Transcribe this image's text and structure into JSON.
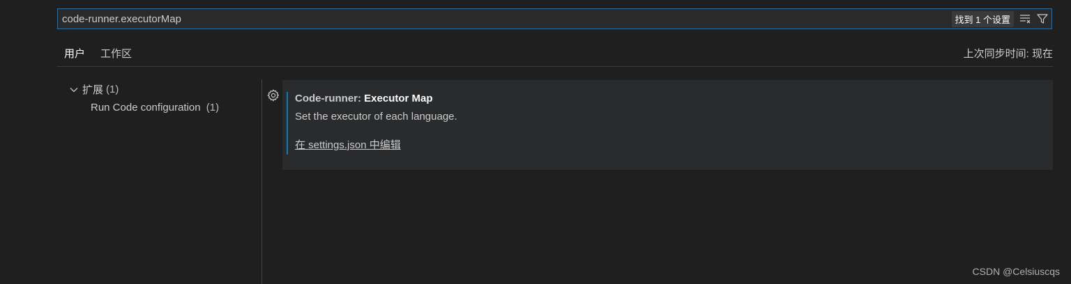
{
  "search": {
    "value": "code-runner.executorMap",
    "result_badge": "找到 1 个设置",
    "clear_filter_icon": "clear-filter-icon",
    "filter_icon": "filter-icon"
  },
  "tabs": {
    "user": "用户",
    "workspace": "工作区"
  },
  "sync_status": "上次同步时间: 现在",
  "toc": {
    "group_label": "扩展",
    "group_count": "(1)",
    "item_label": "Run Code configuration",
    "item_count": "(1)"
  },
  "setting": {
    "category": "Code-runner: ",
    "name": "Executor Map",
    "description": "Set the executor of each language.",
    "edit_link": "在 settings.json 中编辑",
    "gear_icon": "gear-icon"
  },
  "watermark": "CSDN @Celsiuscqs",
  "colors": {
    "accent": "#0078d4",
    "focus_bar": "#0e7ab8",
    "background": "#1f1f1f",
    "card": "#2a2b2d"
  }
}
